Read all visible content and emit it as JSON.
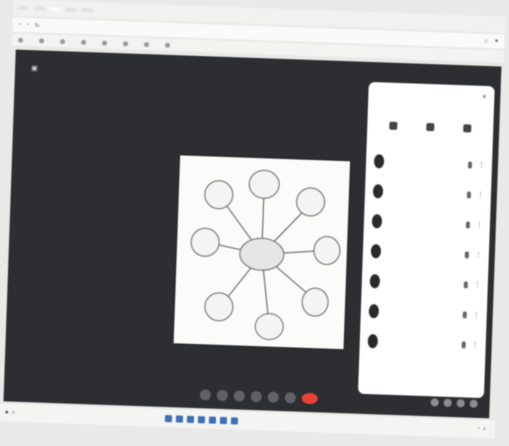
{
  "browser": {
    "tabs": [
      "",
      "",
      "",
      "",
      ""
    ],
    "url": "",
    "bookmarks": [
      "",
      "",
      "",
      "",
      "",
      "",
      "",
      "",
      "",
      ""
    ]
  },
  "meet": {
    "title": "",
    "slide_line": "",
    "meeting_code": "",
    "diagram": {
      "center": "",
      "nodes": [
        "",
        "",
        "",
        "",
        "",
        "",
        "",
        ""
      ]
    }
  },
  "people_panel": {
    "title": "",
    "close": "×",
    "tabs": [
      "",
      "",
      ""
    ],
    "participants": [
      {
        "name": ""
      },
      {
        "name": ""
      },
      {
        "name": ""
      },
      {
        "name": ""
      },
      {
        "name": ""
      },
      {
        "name": ""
      },
      {
        "name": ""
      }
    ]
  },
  "taskbar": {
    "search_placeholder": "",
    "time": "",
    "date": ""
  },
  "colors": {
    "meet_bg": "#2d2e31",
    "leave_red": "#ea4335",
    "panel_bg": "#ffffff"
  }
}
